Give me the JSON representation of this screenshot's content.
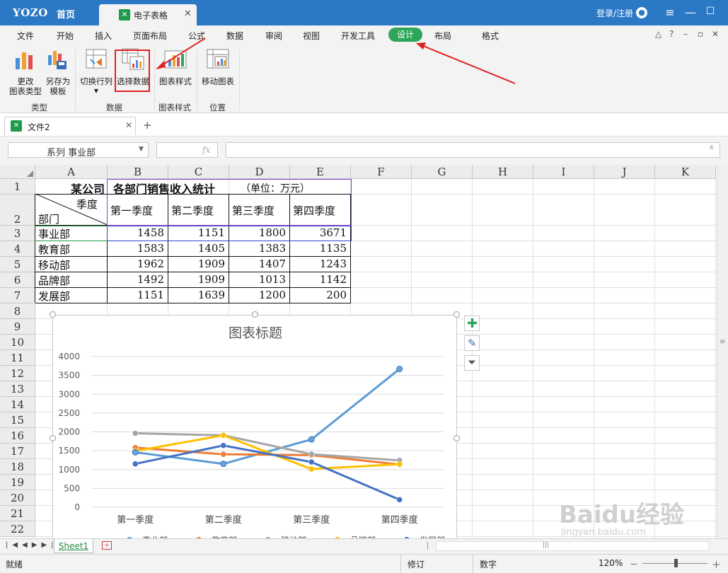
{
  "titlebar": {
    "logo": "YOZO",
    "home": "首页",
    "doc_tab": {
      "icon": "spreadsheet-icon",
      "label": "电子表格"
    },
    "login": "登录/注册"
  },
  "menu": {
    "items": [
      "文件",
      "开始",
      "插入",
      "页面布局",
      "公式",
      "数据",
      "审阅",
      "视图",
      "开发工具",
      "设计",
      "布局",
      "格式"
    ],
    "active": "设计"
  },
  "ribbon": {
    "groups": [
      {
        "label": "类型",
        "buttons": [
          {
            "label": "更改\n图表类型",
            "icon": "chart-type-icon"
          },
          {
            "label": "另存为\n模板",
            "icon": "save-template-icon"
          }
        ]
      },
      {
        "label": "数据",
        "buttons": [
          {
            "label": "切换行列",
            "icon": "switch-rowcol-icon"
          },
          {
            "label": "选择数据",
            "icon": "select-data-icon"
          }
        ]
      },
      {
        "label": "图表样式",
        "buttons": [
          {
            "label": "图表样式",
            "icon": "chart-style-icon"
          }
        ]
      },
      {
        "label": "位置",
        "buttons": [
          {
            "label": "移动图表",
            "icon": "move-chart-icon"
          }
        ]
      }
    ]
  },
  "doctab": {
    "label": "文件2",
    "add": "+"
  },
  "formula_bar": {
    "name_box": "系列 事业部",
    "fx": "fx",
    "value": ""
  },
  "grid": {
    "columns": [
      "A",
      "B",
      "C",
      "D",
      "E",
      "F",
      "G",
      "H",
      "I",
      "J",
      "K"
    ],
    "rows": [
      "1",
      "2",
      "3",
      "4",
      "5",
      "6",
      "7",
      "8",
      "9",
      "10",
      "11",
      "12",
      "13",
      "14",
      "15",
      "16",
      "17",
      "18",
      "19",
      "20",
      "21",
      "22"
    ],
    "table_title_a": "某公司",
    "table_title_b": "各部门销售收入统计",
    "table_unit": "（单位：万元）",
    "header_quarter": "季度",
    "header_dept": "部门",
    "quarters": [
      "第一季度",
      "第二季度",
      "第三季度",
      "第四季度"
    ],
    "departments": [
      "事业部",
      "教育部",
      "移动部",
      "品牌部",
      "发展部"
    ],
    "values": [
      [
        1458,
        1151,
        1800,
        3671
      ],
      [
        1583,
        1405,
        1383,
        1135
      ],
      [
        1962,
        1909,
        1407,
        1243
      ],
      [
        1492,
        1909,
        1013,
        1142
      ],
      [
        1151,
        1639,
        1200,
        200
      ]
    ]
  },
  "chart_data": {
    "type": "line",
    "title": "图表标题",
    "categories": [
      "第一季度",
      "第二季度",
      "第三季度",
      "第四季度"
    ],
    "ylim": [
      0,
      4000
    ],
    "yticks": [
      "0",
      "500",
      "1000",
      "1500",
      "2000",
      "2500",
      "3000",
      "3500",
      "4000"
    ],
    "grid": true,
    "legend": "bottom",
    "series": [
      {
        "name": "事业部",
        "values": [
          1458,
          1151,
          1800,
          3671
        ],
        "color": "#5b9bd5"
      },
      {
        "name": "教育部",
        "values": [
          1583,
          1405,
          1383,
          1135
        ],
        "color": "#ed7d31"
      },
      {
        "name": "移动部",
        "values": [
          1962,
          1909,
          1407,
          1243
        ],
        "color": "#a5a5a5"
      },
      {
        "name": "品牌部",
        "values": [
          1492,
          1909,
          1013,
          1142
        ],
        "color": "#ffc000"
      },
      {
        "name": "发展部",
        "values": [
          1151,
          1639,
          1200,
          200
        ],
        "color": "#4472c4"
      }
    ]
  },
  "sheet": {
    "tab": "Sheet1"
  },
  "status": {
    "left": "就绪",
    "revise": "修订",
    "numeric": "数字",
    "zoom": "120%"
  },
  "watermark": {
    "main": "Baidu经验",
    "sub": "jingyan.baidu.com"
  }
}
